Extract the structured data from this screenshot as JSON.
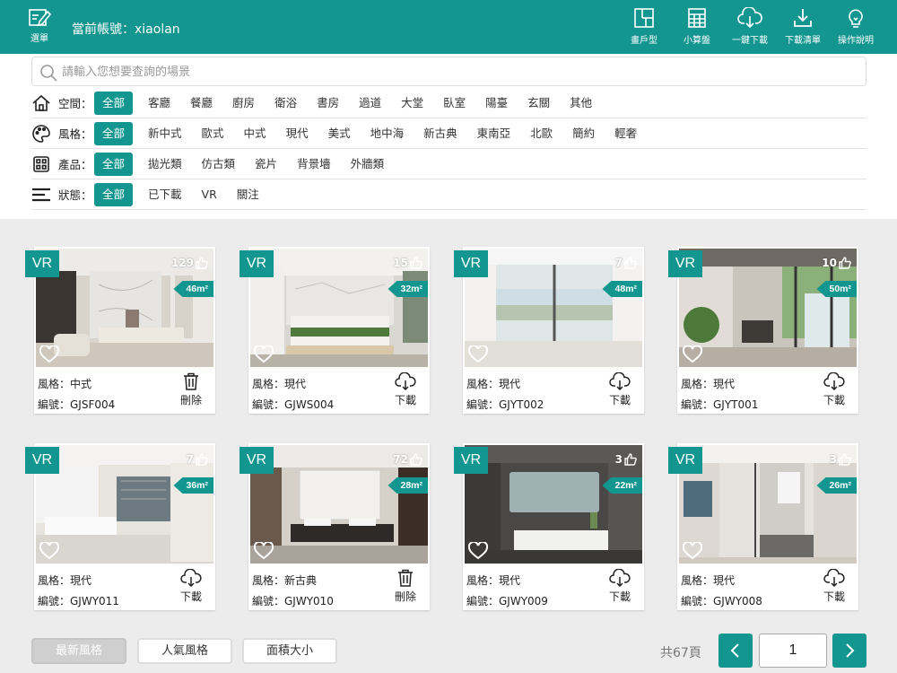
{
  "header": {
    "menu_label": "選單",
    "account_label": "當前帳號：xiaolan",
    "tools": [
      {
        "label": "畫戶型",
        "icon": "floorplan-icon"
      },
      {
        "label": "小算盤",
        "icon": "calculator-icon"
      },
      {
        "label": "一鍵下載",
        "icon": "cloud-download-icon"
      },
      {
        "label": "下載清單",
        "icon": "download-list-icon"
      },
      {
        "label": "操作說明",
        "icon": "lightbulb-icon"
      }
    ]
  },
  "search": {
    "placeholder": "請輸入您想要查詢的場景"
  },
  "filters": {
    "space": {
      "label": "空間：",
      "options": [
        "全部",
        "客廳",
        "餐廳",
        "廚房",
        "衛浴",
        "書房",
        "過道",
        "大堂",
        "臥室",
        "陽臺",
        "玄關",
        "其他"
      ]
    },
    "style": {
      "label": "風格：",
      "options": [
        "全部",
        "新中式",
        "歐式",
        "中式",
        "現代",
        "美式",
        "地中海",
        "新古典",
        "東南亞",
        "北歐",
        "簡約",
        "輕奢"
      ]
    },
    "product": {
      "label": "產品：",
      "options": [
        "全部",
        "拋光類",
        "仿古類",
        "瓷片",
        "背景墻",
        "外牆類"
      ]
    },
    "status": {
      "label": "狀態：",
      "options": [
        "全部",
        "已下載",
        "VR",
        "關注"
      ]
    }
  },
  "cards": [
    {
      "vr": "VR",
      "likes": "129",
      "area": "46m²",
      "style": "風格：中式",
      "code": "編號：GJSF004",
      "action": "刪除",
      "action_icon": "trash-icon",
      "scene": "study"
    },
    {
      "vr": "VR",
      "likes": "15",
      "area": "32m²",
      "style": "風格：現代",
      "code": "編號：GJWS004",
      "action": "下載",
      "action_icon": "cloud-download-icon",
      "scene": "bedroom"
    },
    {
      "vr": "VR",
      "likes": "7",
      "area": "48m²",
      "style": "風格：現代",
      "code": "編號：GJYT002",
      "action": "下載",
      "action_icon": "cloud-download-icon",
      "scene": "balcony"
    },
    {
      "vr": "VR",
      "likes": "10",
      "area": "50m²",
      "style": "風格：現代",
      "code": "編號：GJYT001",
      "action": "下載",
      "action_icon": "cloud-download-icon",
      "scene": "balcony2"
    },
    {
      "vr": "VR",
      "likes": "7",
      "area": "36m²",
      "style": "風格：現代",
      "code": "編號：GJWY011",
      "action": "下載",
      "action_icon": "cloud-download-icon",
      "scene": "bath1"
    },
    {
      "vr": "VR",
      "likes": "72",
      "area": "28m²",
      "style": "風格：新古典",
      "code": "編號：GJWY010",
      "action": "刪除",
      "action_icon": "trash-icon",
      "scene": "bath2"
    },
    {
      "vr": "VR",
      "likes": "3",
      "area": "22m²",
      "style": "風格：現代",
      "code": "編號：GJWY009",
      "action": "下載",
      "action_icon": "cloud-download-icon",
      "scene": "bath3"
    },
    {
      "vr": "VR",
      "likes": "3",
      "area": "26m²",
      "style": "風格：現代",
      "code": "編號：GJWY008",
      "action": "下載",
      "action_icon": "cloud-download-icon",
      "scene": "bath4"
    }
  ],
  "sort": [
    {
      "label": "最新風格",
      "active": true
    },
    {
      "label": "人氣風格",
      "active": false
    },
    {
      "label": "面積大小",
      "active": false
    }
  ],
  "pagination": {
    "total_label": "共67頁",
    "current_page": "1"
  },
  "colors": {
    "accent": "#12968f",
    "background": "#ececec"
  }
}
